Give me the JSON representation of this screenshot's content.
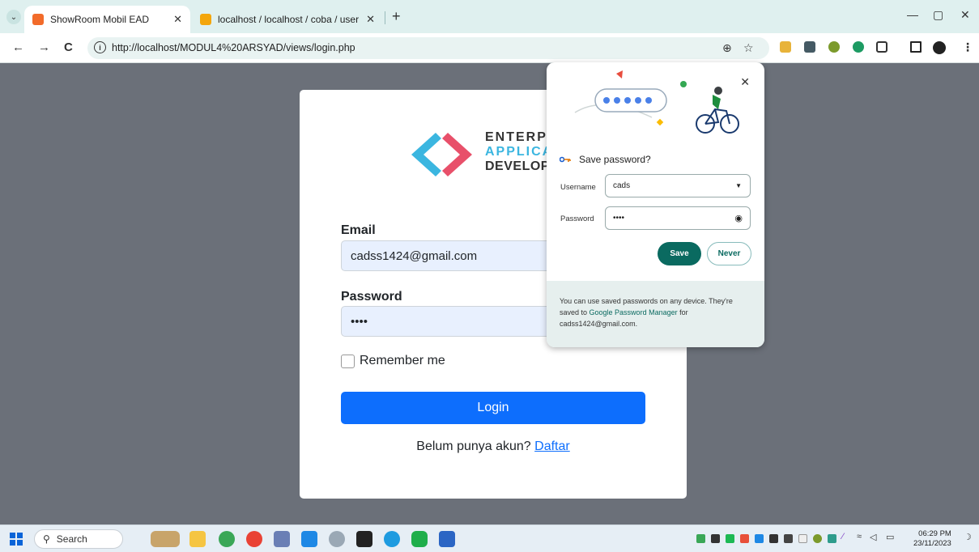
{
  "tabs": [
    {
      "title": "ShowRoom Mobil EAD",
      "close": "✕"
    },
    {
      "title": "localhost / localhost / coba / user",
      "close": "✕"
    }
  ],
  "newtab": "+",
  "window": {
    "minimize": "—",
    "restore": "▢",
    "close": "✕"
  },
  "nav": {
    "back": "←",
    "forward": "→",
    "reload": "C"
  },
  "address": {
    "info": "i",
    "url": "http://localhost/MODUL4%20ARSYAD/views/login.php"
  },
  "logo": {
    "line1": "ENTERPRISE",
    "line2": "APPLICATION",
    "line3": "DEVELOPMENT"
  },
  "form": {
    "email_label": "Email",
    "email_value": "cadss1424@gmail.com",
    "password_label": "Password",
    "password_value": "••••",
    "remember_label": "Remember me",
    "login_label": "Login",
    "signup_text": "Belum punya akun? ",
    "signup_link": "Daftar"
  },
  "popup": {
    "close": "✕",
    "title": "Save password?",
    "username_label": "Username",
    "username_value": "cads",
    "password_label": "Password",
    "password_value": "••••",
    "save_label": "Save",
    "never_label": "Never",
    "footer_pre": "You can use saved passwords on any device. They're saved to ",
    "footer_link": "Google Password Manager",
    "footer_post": " for cadss1424@gmail.com."
  },
  "taskbar": {
    "search_label": "Search",
    "time": "06:29 PM",
    "date": "23/11/2023"
  },
  "colors": {
    "accent": "#0d6efd",
    "popup_accent": "#0a6a60",
    "page_bg": "#6b7079"
  }
}
